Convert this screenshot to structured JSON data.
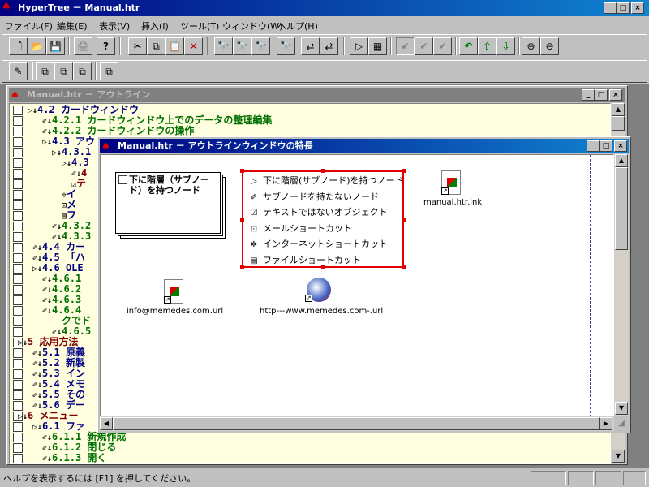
{
  "app": {
    "title": "HyperTree － Manual.htr",
    "controls": [
      "_",
      "□",
      "×"
    ]
  },
  "menu": [
    "ファイル(F)",
    "編集(E)",
    "表示(V)",
    "挿入(I)",
    "ツール(T)",
    "ウィンドウ(W)",
    "ヘルプ(H)"
  ],
  "toolbar": {
    "row1": [
      "🗋",
      "📂",
      "💾",
      "🖨",
      "?",
      "✂",
      "⧉",
      "📋",
      "✕",
      "🔭",
      "🔭",
      "🔭",
      "🔭",
      "⇄",
      "⇄",
      "▷",
      "▦",
      "✔",
      "✔",
      "✔",
      "↶",
      "⇧",
      "⇩",
      "⊕",
      "⊖"
    ],
    "row2": [
      "✎",
      "⧉",
      "⧉",
      "⧉"
    ]
  },
  "outline_window": {
    "title": "Manual.htr － アウトライン",
    "rows": [
      {
        "marker": "▷↓",
        "text": "4.2 カードウィンドウ",
        "color": "navy"
      },
      {
        "marker": "✐↓",
        "text": "4.2.1 カードウィンドウ上でのデータの整理編集",
        "color": "green"
      },
      {
        "marker": "✐↓",
        "text": "4.2.2 カードウィンドウの操作",
        "color": "green"
      },
      {
        "marker": "▷↓",
        "text": "4.3 アウ",
        "color": "navy"
      },
      {
        "marker": "▷↓",
        "text": "4.3.1",
        "color": "navy"
      },
      {
        "marker": "▷↓",
        "text": "4.3",
        "color": "navy"
      },
      {
        "marker": "✐↓",
        "text": "4",
        "color": "red"
      },
      {
        "marker": "☑",
        "text": "テ",
        "color": "red"
      },
      {
        "marker": "✲",
        "text": "イ",
        "color": "navy"
      },
      {
        "marker": "⊡",
        "text": "メ",
        "color": "navy"
      },
      {
        "marker": "▤",
        "text": "フ",
        "color": "navy"
      },
      {
        "marker": "✐↓",
        "text": "4.3.2",
        "color": "green"
      },
      {
        "marker": "✐↓",
        "text": "4.3.3",
        "color": "green"
      },
      {
        "marker": "✐↓",
        "text": "4.4 カー",
        "color": "navy"
      },
      {
        "marker": "✐↓",
        "text": "4.5 「ハ",
        "color": "navy"
      },
      {
        "marker": "▷↓",
        "text": "4.6 OLE",
        "color": "navy"
      },
      {
        "marker": "✐↓",
        "text": "4.6.1",
        "color": "green"
      },
      {
        "marker": "✐↓",
        "text": "4.6.2",
        "color": "green"
      },
      {
        "marker": "✐↓",
        "text": "4.6.3",
        "color": "green"
      },
      {
        "marker": "✐↓",
        "text": "4.6.4",
        "color": "green"
      },
      {
        "marker": "",
        "text": "クでド",
        "color": "green"
      },
      {
        "marker": "✐↓",
        "text": "4.6.5",
        "color": "green"
      },
      {
        "marker": "▷↓",
        "text": "5 応用方法",
        "color": "red"
      },
      {
        "marker": "✐↓",
        "text": "5.1 原義",
        "color": "navy"
      },
      {
        "marker": "✐↓",
        "text": "5.2 新製",
        "color": "navy"
      },
      {
        "marker": "✐↓",
        "text": "5.3 イン",
        "color": "navy"
      },
      {
        "marker": "✐↓",
        "text": "5.4 メモ",
        "color": "navy"
      },
      {
        "marker": "✐↓",
        "text": "5.5 その",
        "color": "navy"
      },
      {
        "marker": "✐↓",
        "text": "5.6 デー",
        "color": "navy"
      },
      {
        "marker": "▷↓",
        "text": "6 メニュー",
        "color": "red"
      },
      {
        "marker": "▷↓",
        "text": "6.1 ファ",
        "color": "navy"
      },
      {
        "marker": "✐↓",
        "text": "6.1.1 新規作成",
        "color": "green"
      },
      {
        "marker": "✐↓",
        "text": "6.1.2 閉じる",
        "color": "green"
      },
      {
        "marker": "✐↓",
        "text": "6.1.3 開く",
        "color": "green"
      }
    ]
  },
  "feature_window": {
    "title": "Manual.htr － アウトラインウィンドウの特長",
    "card_note": "下に階層（サブノード）を持つノード",
    "legend": [
      {
        "icon": "▷",
        "label": "下に階層(サブノード)を持つノード"
      },
      {
        "icon": "✐",
        "label": "サブノードを持たないノード"
      },
      {
        "icon": "☑",
        "label": "テキストではないオブジェクト"
      },
      {
        "icon": "⊡",
        "label": "メールショートカット"
      },
      {
        "icon": "✲",
        "label": "インターネットショートカット"
      },
      {
        "icon": "▤",
        "label": "ファイルショートカット"
      }
    ],
    "files": {
      "lnk": "manual.htr.lnk",
      "mail": "info@memedes.com.url",
      "web": "http---www.memedes.com-.url"
    }
  },
  "status": {
    "text": "ヘルプを表示するには [F1] を押してください。"
  },
  "colors": {
    "title_active": "#000080",
    "outline_bg": "#ffffe0",
    "selection_red": "#e00000"
  }
}
